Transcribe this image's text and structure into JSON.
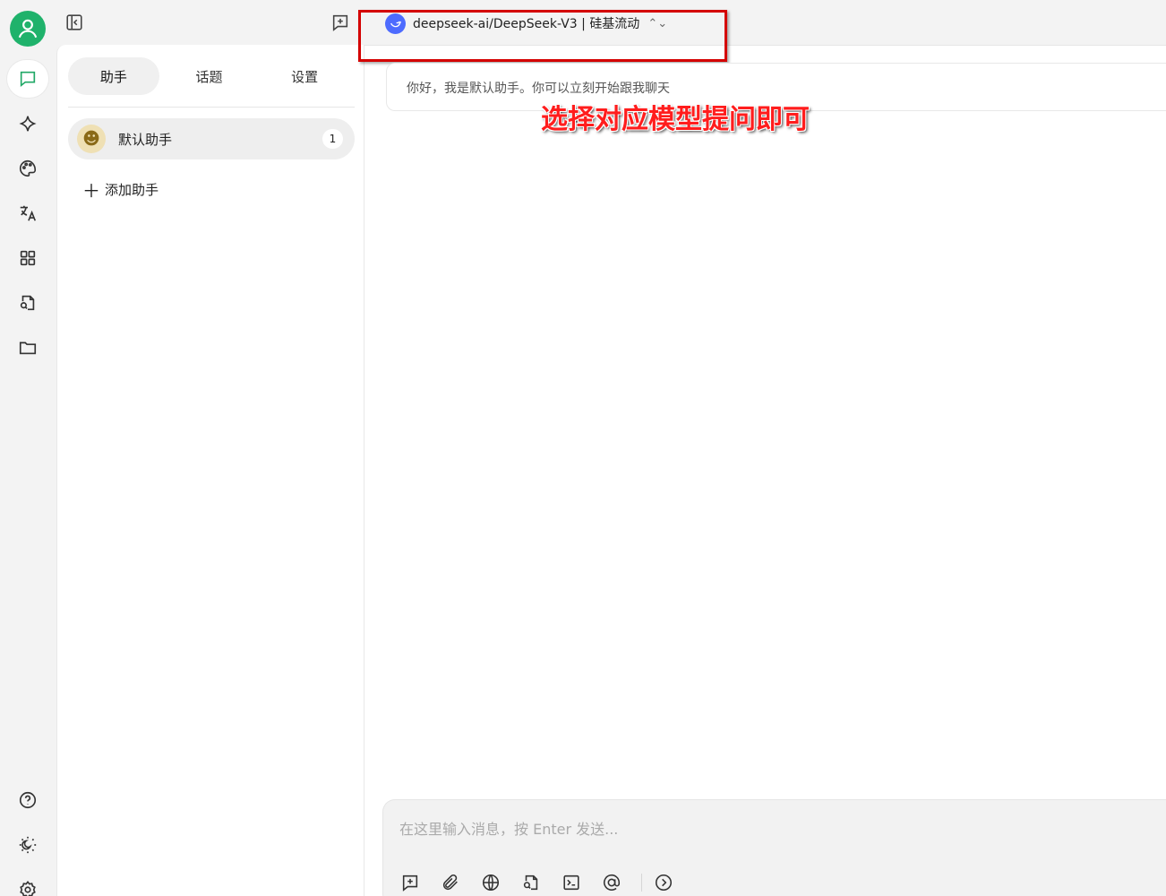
{
  "rail": {
    "items": [
      "chat-icon",
      "sparkle-icon",
      "palette-icon",
      "translate-icon",
      "apps-icon",
      "doc-search-icon",
      "folder-icon"
    ],
    "bottom": [
      "help-icon",
      "theme-icon",
      "settings-icon"
    ]
  },
  "panel": {
    "tabs": [
      {
        "label": "助手",
        "active": true
      },
      {
        "label": "话题",
        "active": false
      },
      {
        "label": "设置",
        "active": false
      }
    ],
    "assistant": {
      "label": "默认助手",
      "count": "1"
    },
    "add_label": "添加助手"
  },
  "chat": {
    "model_name": "deepseek-ai/DeepSeek-V3 | 硅基流动",
    "welcome": "你好，我是默认助手。你可以立刻开始跟我聊天",
    "annotation": "选择对应模型提问即可",
    "input_placeholder": "在这里输入消息，按 Enter 发送..."
  },
  "colors": {
    "accent_green": "#1fb26b",
    "annotation_red": "#ff1d1d",
    "model_blue": "#4d6bfe"
  }
}
